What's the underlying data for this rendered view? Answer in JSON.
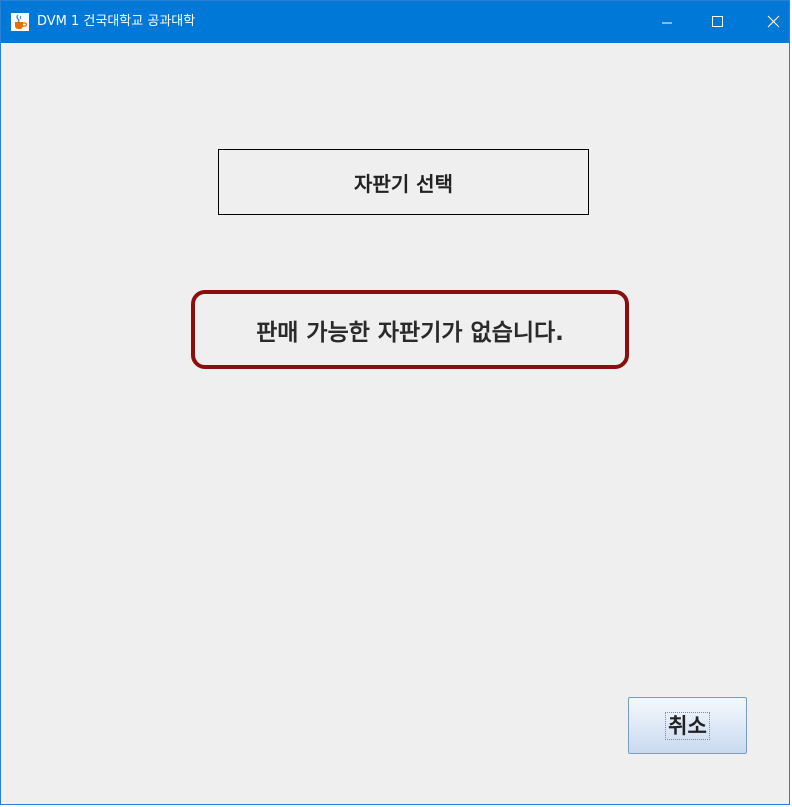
{
  "window": {
    "title": "DVM 1 건국대학교 공과대학",
    "icon": "java-cup-icon",
    "controls": {
      "minimize_icon": "minimize-icon",
      "maximize_icon": "maximize-icon",
      "close_icon": "close-icon"
    },
    "colors": {
      "titlebar": "#0078d7",
      "background": "#efefef"
    }
  },
  "main": {
    "section_title": "자판기 선택",
    "message": "판매 가능한 자판기가 없습니다.",
    "message_border_color": "#8b0d0d"
  },
  "footer": {
    "cancel_label": "취소"
  }
}
